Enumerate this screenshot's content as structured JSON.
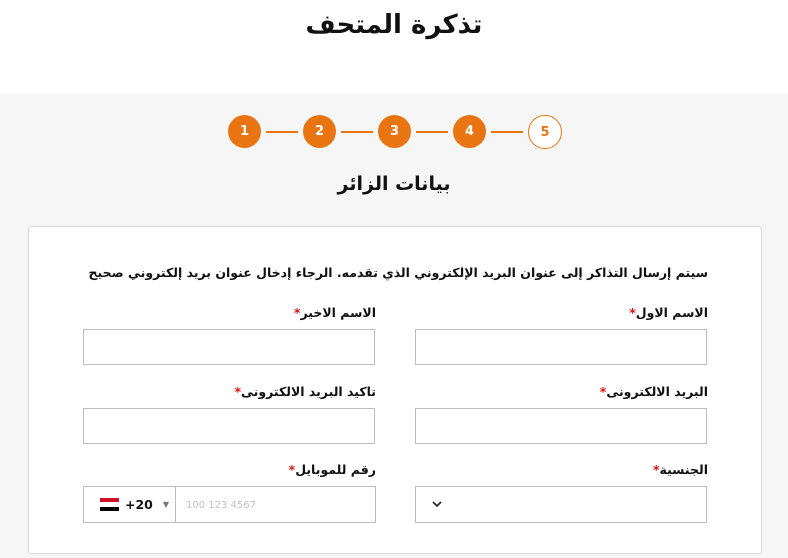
{
  "header": {
    "title": "تذكرة المتحف"
  },
  "stepper": {
    "steps": [
      "1",
      "2",
      "3",
      "4",
      "5"
    ],
    "current_step": 5,
    "accent_color": "#e87511"
  },
  "section": {
    "title": "بيانات الزائر"
  },
  "form": {
    "notice": "سيتم إرسال التذاكر إلى عنوان البريد الإلكتروني الذي تقدمه. الرجاء إدخال عنوان بريد إلكتروني صحيح",
    "required_marker": "*",
    "first_name": {
      "label": "الاسم الاول",
      "value": ""
    },
    "last_name": {
      "label": "الاسم الاخير",
      "value": ""
    },
    "email": {
      "label": "البريد الالكترونى",
      "value": ""
    },
    "confirm_email": {
      "label": "تاكيد البريد الالكترونى",
      "value": ""
    },
    "nationality": {
      "label": "الجنسية",
      "value": "",
      "icon": "chevron-down-icon"
    },
    "mobile": {
      "label": "رقم للموبايل",
      "country_code": "+20",
      "country_flag": "egypt-flag-icon",
      "placeholder": "100 123 4567",
      "value": ""
    }
  }
}
